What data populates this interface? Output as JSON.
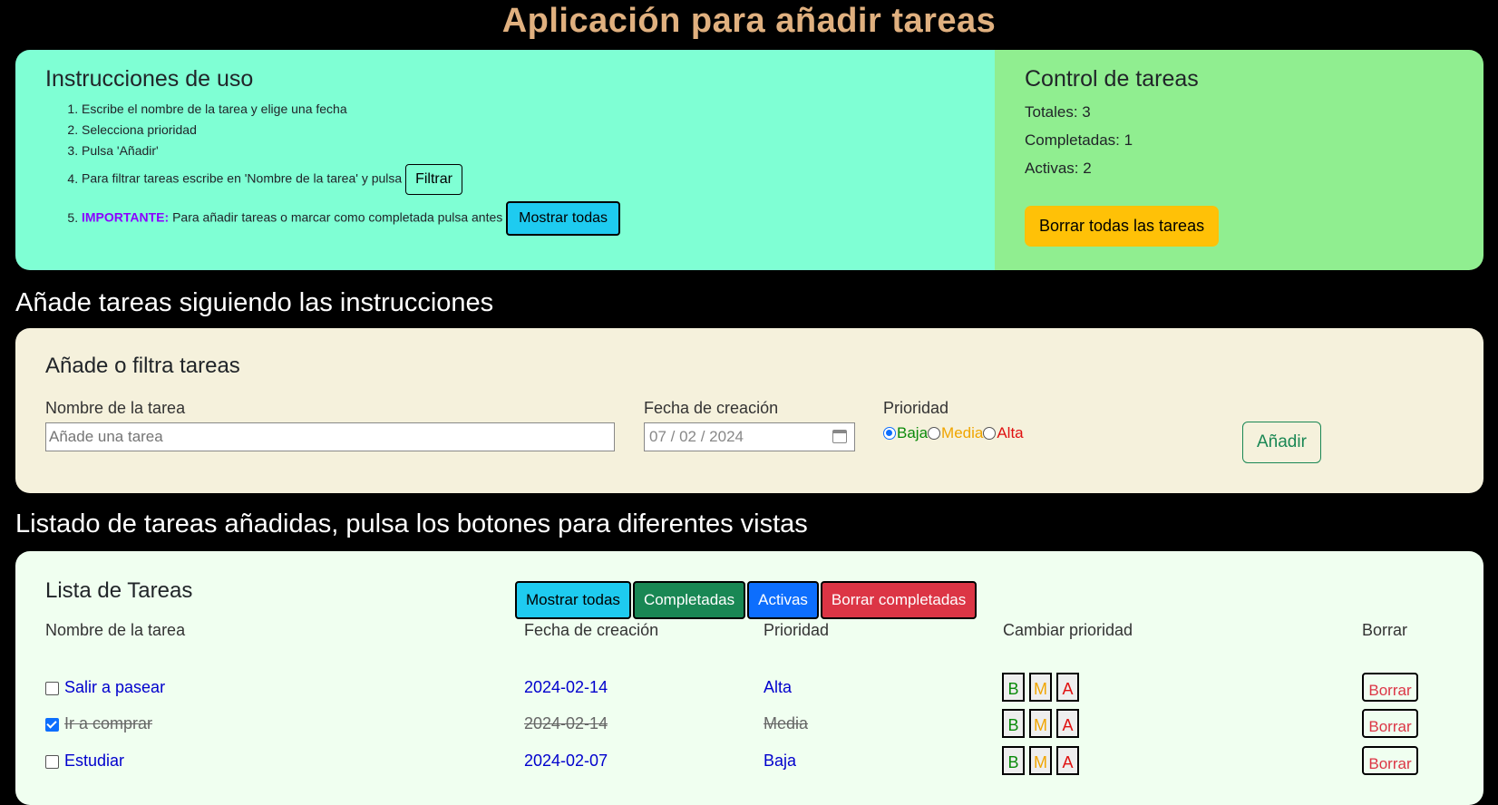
{
  "app_title": "Aplicación para añadir tareas",
  "instructions": {
    "title": "Instrucciones de uso",
    "step1": "Escribe el nombre de la tarea y elige una fecha",
    "step2": "Selecciona prioridad",
    "step3": "Pulsa 'Añadir'",
    "step4": "Para filtrar tareas escribe en 'Nombre de la tarea' y pulsa",
    "step4_button": "Filtrar",
    "step5_important": "IMPORTANTE:",
    "step5": "Para añadir tareas o marcar como completada pulsa antes",
    "step5_button": "Mostrar todas"
  },
  "control": {
    "title": "Control de tareas",
    "total": "Totales: 3",
    "completed": "Completadas: 1",
    "active": "Activas: 2",
    "delete_all": "Borrar todas las tareas"
  },
  "add_heading": "Añade tareas siguiendo las instrucciones",
  "add_form": {
    "title": "Añade o filtra tareas",
    "name_label": "Nombre de la tarea",
    "name_placeholder": "Añade una tarea",
    "date_label": "Fecha de creación",
    "date_value": "07 / 02 / 2024",
    "priority_label": "Prioridad",
    "priority_options": [
      "Baja",
      "Media",
      "Alta"
    ],
    "priority_selected": "Baja",
    "add_button": "Añadir"
  },
  "list_heading": "Listado de tareas añadidas, pulsa los botones para diferentes vistas",
  "task_list": {
    "title": "Lista de Tareas",
    "view_buttons": [
      "Mostrar todas",
      "Completadas",
      "Activas",
      "Borrar completadas"
    ],
    "columns": [
      "Nombre de la tarea",
      "Fecha de creación",
      "Prioridad",
      "Cambiar prioridad",
      "Borrar"
    ],
    "priority_buttons": [
      "B",
      "M",
      "A"
    ],
    "delete_label": "Borrar",
    "rows": [
      {
        "name": "Salir a pasear",
        "date": "2024-02-14",
        "priority": "Alta",
        "done": false
      },
      {
        "name": "Ir a comprar",
        "date": "2024-02-14",
        "priority": "Media",
        "done": true
      },
      {
        "name": "Estudiar",
        "date": "2024-02-07",
        "priority": "Baja",
        "done": false
      }
    ]
  }
}
